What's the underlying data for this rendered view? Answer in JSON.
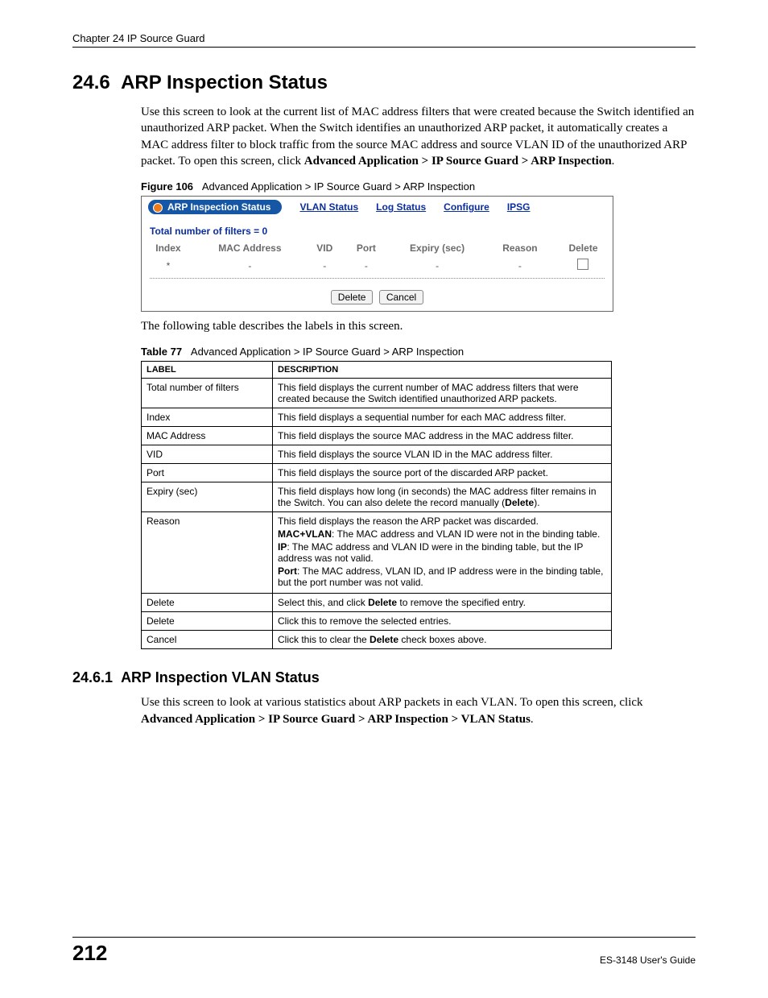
{
  "header": {
    "chapter": "Chapter 24 IP Source Guard"
  },
  "section": {
    "number": "24.6",
    "title": "ARP Inspection Status",
    "intro": "Use this screen to look at the current list of MAC address filters that were created because the Switch identified an unauthorized ARP packet. When the Switch identifies an unauthorized ARP packet, it automatically creates a MAC address filter to block traffic from the source MAC address and source VLAN ID of the unauthorized ARP packet. To open this screen, click ",
    "intro_bold": "Advanced Application > IP Source Guard > ARP Inspection",
    "intro_end": "."
  },
  "figure": {
    "label": "Figure 106",
    "caption": "Advanced Application > IP Source Guard > ARP Inspection"
  },
  "screenshot": {
    "tabs": {
      "active": "ARP Inspection Status",
      "links": [
        "VLAN Status",
        "Log Status",
        "Configure",
        "IPSG"
      ]
    },
    "filters_line": "Total number of filters = 0",
    "columns": [
      "Index",
      "MAC Address",
      "VID",
      "Port",
      "Expiry (sec)",
      "Reason",
      "Delete"
    ],
    "row": [
      "*",
      "-",
      "-",
      "-",
      "-",
      "-",
      "checkbox"
    ],
    "buttons": {
      "delete": "Delete",
      "cancel": "Cancel"
    }
  },
  "table_intro": "The following table describes the labels in this screen.",
  "table": {
    "label": "Table 77",
    "caption": "Advanced Application > IP Source Guard > ARP Inspection",
    "head": {
      "c1": "LABEL",
      "c2": "DESCRIPTION"
    },
    "rows": [
      {
        "label": "Total number of filters",
        "desc": "This field displays the current number of MAC address filters that were created because the Switch identified unauthorized ARP packets."
      },
      {
        "label": "Index",
        "desc": "This field displays a sequential number for each MAC address filter."
      },
      {
        "label": "MAC Address",
        "desc": "This field displays the source MAC address in the MAC address filter."
      },
      {
        "label": "VID",
        "desc": "This field displays the source VLAN ID in the MAC address filter."
      },
      {
        "label": "Port",
        "desc": "This field displays the source port of the discarded ARP packet."
      },
      {
        "label": "Expiry (sec)",
        "desc_parts": [
          "This field displays how long (in seconds) the MAC address filter remains in the Switch. You can also delete the record manually (",
          "Delete",
          ")."
        ]
      },
      {
        "label": "Reason",
        "reason": {
          "intro": "This field displays the reason the ARP packet was discarded.",
          "macvlan_b": "MAC+VLAN",
          "macvlan_t": ": The MAC address and VLAN ID were not in the binding table.",
          "ip_b": "IP",
          "ip_t": ": The MAC address and VLAN ID were in the binding table, but the IP address was not valid.",
          "port_b": "Port",
          "port_t": ": The MAC address, VLAN ID, and IP address were in the binding table, but the port number was not valid."
        }
      },
      {
        "label": "Delete",
        "desc_parts": [
          "Select this, and click ",
          "Delete",
          " to remove the specified entry."
        ]
      },
      {
        "label": "Delete",
        "desc": "Click this to remove the selected entries."
      },
      {
        "label": "Cancel",
        "desc_parts": [
          "Click this to clear the ",
          "Delete",
          " check boxes above."
        ]
      }
    ]
  },
  "subsection": {
    "number": "24.6.1",
    "title": "ARP Inspection VLAN Status",
    "body_pre": "Use this screen to look at various statistics about ARP packets in each VLAN. To open this screen, click ",
    "body_bold": "Advanced Application > IP Source Guard > ARP Inspection > VLAN Status",
    "body_end": "."
  },
  "footer": {
    "page": "212",
    "guide": "ES-3148 User's Guide"
  }
}
